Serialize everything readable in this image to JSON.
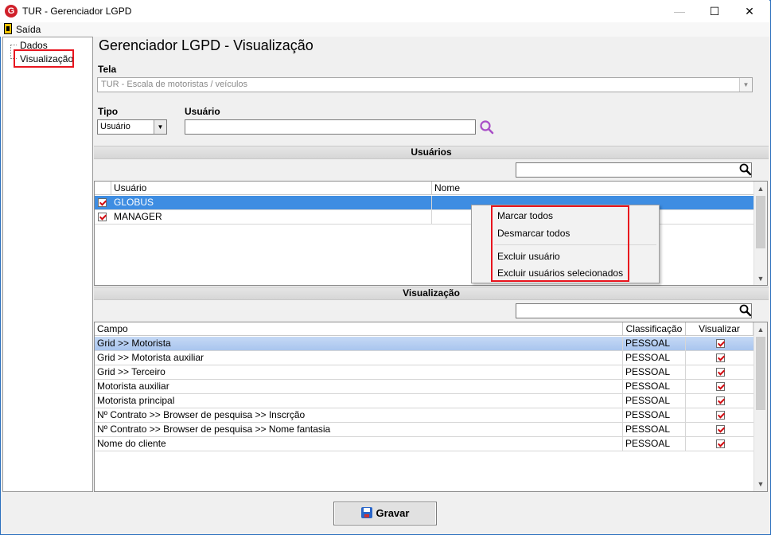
{
  "window": {
    "title": "TUR - Gerenciador LGPD",
    "icon_letter": "G"
  },
  "menu": {
    "exit": "Saída"
  },
  "tree": {
    "items": [
      "Dados",
      "Visualização"
    ]
  },
  "page": {
    "title": "Gerenciador LGPD - Visualização"
  },
  "form": {
    "tela_label": "Tela",
    "tela_value": "TUR - Escala de motoristas / veículos",
    "tipo_label": "Tipo",
    "tipo_value": "Usuário",
    "usuario_label": "Usuário",
    "usuario_value": ""
  },
  "users_section": {
    "title": "Usuários",
    "columns": [
      "Usuário",
      "Nome"
    ],
    "rows": [
      {
        "usuario": "GLOBUS",
        "nome": "",
        "checked": true,
        "selected": true
      },
      {
        "usuario": "MANAGER",
        "nome": "",
        "checked": true,
        "selected": false
      }
    ]
  },
  "context_menu": {
    "items": [
      "Marcar todos",
      "Desmarcar todos",
      "Excluir usuário",
      "Excluir usuários selecionados"
    ]
  },
  "view_section": {
    "title": "Visualização",
    "columns": [
      "Campo",
      "Classificação",
      "Visualizar"
    ],
    "rows": [
      {
        "campo": "Grid >> Motorista",
        "classificacao": "PESSOAL",
        "visualizar": true
      },
      {
        "campo": "Grid >> Motorista auxiliar",
        "classificacao": "PESSOAL",
        "visualizar": true
      },
      {
        "campo": "Grid >> Terceiro",
        "classificacao": "PESSOAL",
        "visualizar": true
      },
      {
        "campo": "Motorista auxiliar",
        "classificacao": "PESSOAL",
        "visualizar": true
      },
      {
        "campo": "Motorista principal",
        "classificacao": "PESSOAL",
        "visualizar": true
      },
      {
        "campo": "Nº Contrato >> Browser de pesquisa >> Inscrção",
        "classificacao": "PESSOAL",
        "visualizar": true
      },
      {
        "campo": "Nº Contrato >> Browser de pesquisa >> Nome fantasia",
        "classificacao": "PESSOAL",
        "visualizar": true
      },
      {
        "campo": "Nome do cliente",
        "classificacao": "PESSOAL",
        "visualizar": true
      }
    ]
  },
  "buttons": {
    "save": "Gravar"
  },
  "colors": {
    "highlight_red": "#e8141e",
    "selection_blue": "#3e8de2",
    "search_purple": "#a94fc7"
  }
}
